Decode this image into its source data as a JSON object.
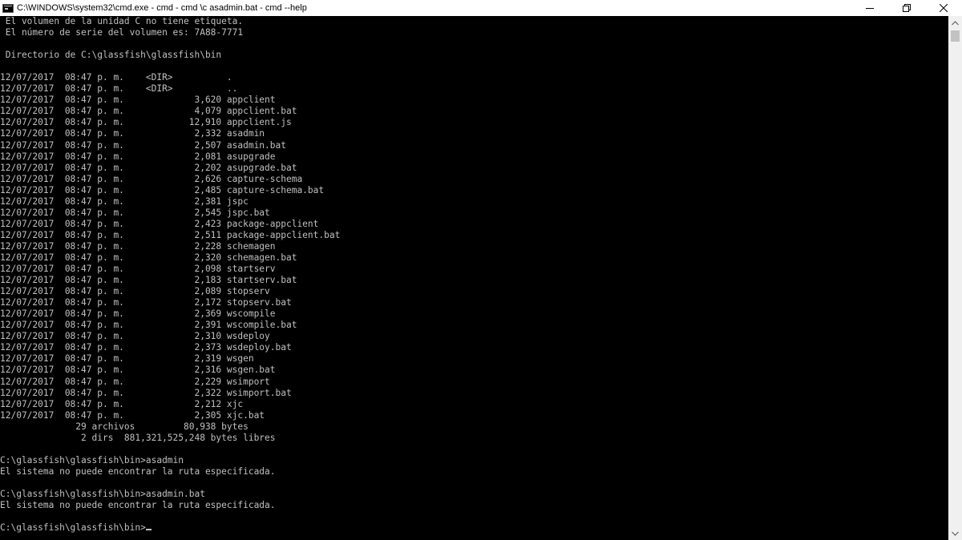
{
  "window": {
    "title": "C:\\WINDOWS\\system32\\cmd.exe - cmd - cmd  \\c asadmin.bat - cmd  --help"
  },
  "controls": {
    "minimize_icon": "minimize-icon",
    "restore_icon": "restore-icon",
    "close_icon": "close-icon"
  },
  "console": {
    "lines": [
      " El volumen de la unidad C no tiene etiqueta.",
      " El número de serie del volumen es: 7A88-7771",
      "",
      " Directorio de C:\\glassfish\\glassfish\\bin",
      "",
      "12/07/2017  08:47 p. m.    <DIR>          .",
      "12/07/2017  08:47 p. m.    <DIR>          ..",
      "12/07/2017  08:47 p. m.             3,620 appclient",
      "12/07/2017  08:47 p. m.             4,079 appclient.bat",
      "12/07/2017  08:47 p. m.            12,910 appclient.js",
      "12/07/2017  08:47 p. m.             2,332 asadmin",
      "12/07/2017  08:47 p. m.             2,507 asadmin.bat",
      "12/07/2017  08:47 p. m.             2,081 asupgrade",
      "12/07/2017  08:47 p. m.             2,202 asupgrade.bat",
      "12/07/2017  08:47 p. m.             2,626 capture-schema",
      "12/07/2017  08:47 p. m.             2,485 capture-schema.bat",
      "12/07/2017  08:47 p. m.             2,381 jspc",
      "12/07/2017  08:47 p. m.             2,545 jspc.bat",
      "12/07/2017  08:47 p. m.             2,423 package-appclient",
      "12/07/2017  08:47 p. m.             2,511 package-appclient.bat",
      "12/07/2017  08:47 p. m.             2,228 schemagen",
      "12/07/2017  08:47 p. m.             2,320 schemagen.bat",
      "12/07/2017  08:47 p. m.             2,098 startserv",
      "12/07/2017  08:47 p. m.             2,183 startserv.bat",
      "12/07/2017  08:47 p. m.             2,089 stopserv",
      "12/07/2017  08:47 p. m.             2,172 stopserv.bat",
      "12/07/2017  08:47 p. m.             2,369 wscompile",
      "12/07/2017  08:47 p. m.             2,391 wscompile.bat",
      "12/07/2017  08:47 p. m.             2,310 wsdeploy",
      "12/07/2017  08:47 p. m.             2,373 wsdeploy.bat",
      "12/07/2017  08:47 p. m.             2,319 wsgen",
      "12/07/2017  08:47 p. m.             2,316 wsgen.bat",
      "12/07/2017  08:47 p. m.             2,229 wsimport",
      "12/07/2017  08:47 p. m.             2,322 wsimport.bat",
      "12/07/2017  08:47 p. m.             2,212 xjc",
      "12/07/2017  08:47 p. m.             2,305 xjc.bat",
      "              29 archivos         80,938 bytes",
      "               2 dirs  881,321,525,248 bytes libres",
      "",
      "C:\\glassfish\\glassfish\\bin>asadmin",
      "El sistema no puede encontrar la ruta especificada.",
      "",
      "C:\\glassfish\\glassfish\\bin>asadmin.bat",
      "El sistema no puede encontrar la ruta especificada.",
      "",
      "C:\\glassfish\\glassfish\\bin>"
    ]
  },
  "colors": {
    "console_bg": "#000000",
    "console_fg": "#c0c0c0",
    "titlebar_bg": "#ffffff",
    "scrollbar_track": "#f0f0f0",
    "scrollbar_thumb": "#c2c2c2"
  }
}
